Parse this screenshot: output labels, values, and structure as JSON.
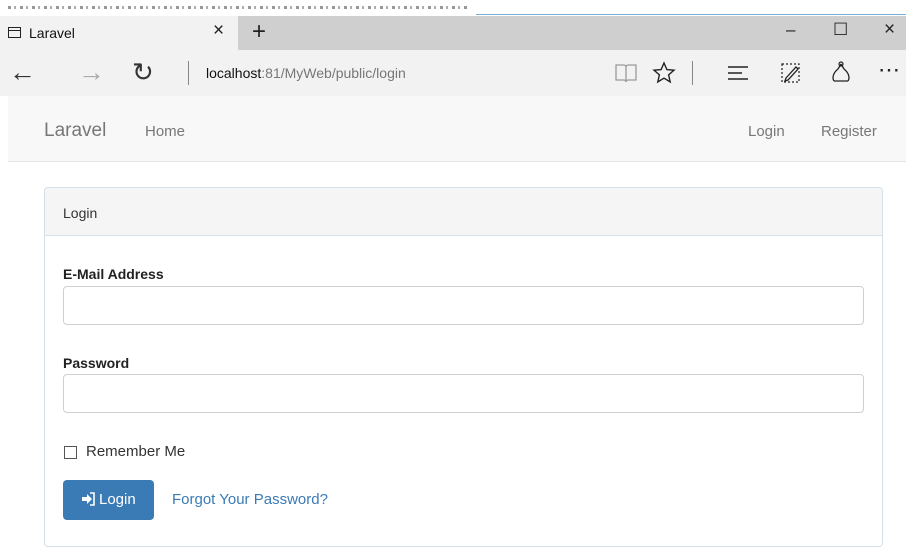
{
  "browser": {
    "tab_title": "Laravel",
    "tab_close": "×",
    "new_tab": "+",
    "minimize": "–",
    "maximize": "☐",
    "close": "×",
    "back": "←",
    "forward": "→",
    "refresh": "↻",
    "url_host": "localhost",
    "url_rest": ":81/MyWeb/public/login",
    "more": "⋯"
  },
  "navbar": {
    "brand": "Laravel",
    "home": "Home",
    "login": "Login",
    "register": "Register"
  },
  "panel": {
    "title": "Login",
    "email_label": "E-Mail Address",
    "email_value": "",
    "password_label": "Password",
    "password_value": "",
    "remember_label": "Remember Me",
    "remember_checked": false,
    "login_button": "Login",
    "forgot_link": "Forgot Your Password?"
  },
  "colors": {
    "primary": "#3a7ab5",
    "panel_border": "#d3e0e9",
    "navbar_bg": "#f8f8f8"
  }
}
